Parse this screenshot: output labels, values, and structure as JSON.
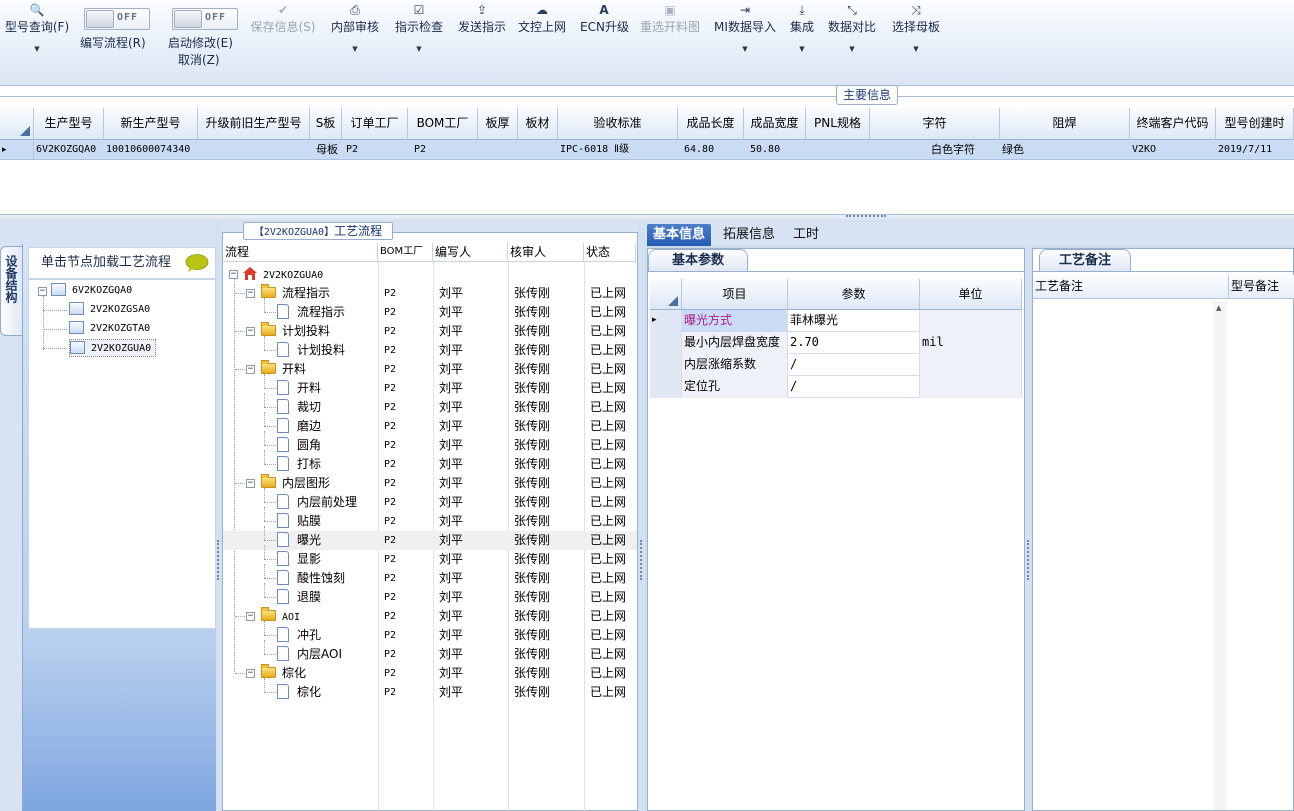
{
  "toolbar": {
    "buttons": [
      {
        "label": "型号查询(F)",
        "icon": "search-icon",
        "dropdown": true
      },
      {
        "label": "保存信息(S)",
        "icon": "check-icon",
        "disabled": true
      },
      {
        "label": "内部审核",
        "icon": "printer-icon",
        "dropdown": true
      },
      {
        "label": "指示检查",
        "icon": "check-square-icon",
        "dropdown": true
      },
      {
        "label": "发送指示",
        "icon": "upload-icon"
      },
      {
        "label": "文控上网",
        "icon": "cloud-upload-icon"
      },
      {
        "label": "ECN升级",
        "icon": "text-a-icon"
      },
      {
        "label": "重选开料图",
        "icon": "image-icon",
        "disabled": true
      },
      {
        "label": "MI数据导入",
        "icon": "sign-in-icon",
        "dropdown": true
      },
      {
        "label": "集成",
        "icon": "download-icon",
        "dropdown": true
      },
      {
        "label": "数据对比",
        "icon": "compress-icon",
        "dropdown": true
      },
      {
        "label": "选择母板",
        "icon": "shuffle-icon",
        "dropdown": true
      }
    ],
    "toggles": [
      {
        "label": "编写流程(R)",
        "state": "OFF"
      },
      {
        "label": "启动修改(E)",
        "sublabel": "取消(Z)",
        "state": "OFF"
      }
    ]
  },
  "main_info": {
    "title": "主要信息",
    "columns": [
      "生产型号",
      "新生产型号",
      "升级前旧生产型号",
      "S板",
      "订单工厂",
      "BOM工厂",
      "板厚",
      "板材",
      "验收标准",
      "成品长度",
      "成品宽度",
      "PNL规格",
      "字符",
      "阻焊",
      "终端客户代码",
      "型号创建时"
    ],
    "rows": [
      [
        "6V2KOZGQA0",
        "10010600074340",
        "",
        "母板",
        "P2",
        "P2",
        "",
        "",
        "IPC-6018 Ⅱ级",
        "64.80",
        "50.80",
        "",
        "白色字符",
        "绿色",
        "V2KO",
        "2019/7/11"
      ]
    ]
  },
  "structure": {
    "vtab_label": "设备结构",
    "load_hint": "单击节点加载工艺流程",
    "tree": [
      {
        "label": "6V2KOZGQA0",
        "level": 0
      },
      {
        "label": "2V2KOZGSA0",
        "level": 1
      },
      {
        "label": "2V2KOZGTA0",
        "level": 1
      },
      {
        "label": "2V2KOZGUA0",
        "level": 1,
        "selected": true
      }
    ]
  },
  "process": {
    "title_code": "【2V2KOZGUA0】",
    "title_text": "工艺流程",
    "columns": [
      "流程",
      "BOM工厂",
      "编写人",
      "核审人",
      "状态"
    ],
    "rows": [
      {
        "name": "2V2KOZGUA0",
        "type": "root",
        "level": 0,
        "bom": "",
        "writer": "",
        "reviewer": "",
        "status": ""
      },
      {
        "name": "流程指示",
        "type": "folder",
        "level": 1,
        "bom": "P2",
        "writer": "刘平",
        "reviewer": "张传刚",
        "status": "已上网"
      },
      {
        "name": "流程指示",
        "type": "doc",
        "level": 2,
        "bom": "P2",
        "writer": "刘平",
        "reviewer": "张传刚",
        "status": "已上网"
      },
      {
        "name": "计划投料",
        "type": "folder",
        "level": 1,
        "bom": "P2",
        "writer": "刘平",
        "reviewer": "张传刚",
        "status": "已上网"
      },
      {
        "name": "计划投料",
        "type": "doc",
        "level": 2,
        "bom": "P2",
        "writer": "刘平",
        "reviewer": "张传刚",
        "status": "已上网"
      },
      {
        "name": "开料",
        "type": "folder",
        "level": 1,
        "bom": "P2",
        "writer": "刘平",
        "reviewer": "张传刚",
        "status": "已上网"
      },
      {
        "name": "开料",
        "type": "doc",
        "level": 2,
        "bom": "P2",
        "writer": "刘平",
        "reviewer": "张传刚",
        "status": "已上网"
      },
      {
        "name": "裁切",
        "type": "doc",
        "level": 2,
        "bom": "P2",
        "writer": "刘平",
        "reviewer": "张传刚",
        "status": "已上网"
      },
      {
        "name": "磨边",
        "type": "doc",
        "level": 2,
        "bom": "P2",
        "writer": "刘平",
        "reviewer": "张传刚",
        "status": "已上网"
      },
      {
        "name": "圆角",
        "type": "doc",
        "level": 2,
        "bom": "P2",
        "writer": "刘平",
        "reviewer": "张传刚",
        "status": "已上网"
      },
      {
        "name": "打标",
        "type": "doc",
        "level": 2,
        "bom": "P2",
        "writer": "刘平",
        "reviewer": "张传刚",
        "status": "已上网"
      },
      {
        "name": "内层图形",
        "type": "folder",
        "level": 1,
        "bom": "P2",
        "writer": "刘平",
        "reviewer": "张传刚",
        "status": "已上网"
      },
      {
        "name": "内层前处理",
        "type": "doc",
        "level": 2,
        "bom": "P2",
        "writer": "刘平",
        "reviewer": "张传刚",
        "status": "已上网"
      },
      {
        "name": "贴膜",
        "type": "doc",
        "level": 2,
        "bom": "P2",
        "writer": "刘平",
        "reviewer": "张传刚",
        "status": "已上网"
      },
      {
        "name": "曝光",
        "type": "doc",
        "level": 2,
        "bom": "P2",
        "writer": "刘平",
        "reviewer": "张传刚",
        "status": "已上网",
        "selected": true
      },
      {
        "name": "显影",
        "type": "doc",
        "level": 2,
        "bom": "P2",
        "writer": "刘平",
        "reviewer": "张传刚",
        "status": "已上网"
      },
      {
        "name": "酸性蚀刻",
        "type": "doc",
        "level": 2,
        "bom": "P2",
        "writer": "刘平",
        "reviewer": "张传刚",
        "status": "已上网"
      },
      {
        "name": "退膜",
        "type": "doc",
        "level": 2,
        "bom": "P2",
        "writer": "刘平",
        "reviewer": "张传刚",
        "status": "已上网"
      },
      {
        "name": "AOI",
        "type": "folder",
        "level": 1,
        "bom": "P2",
        "writer": "刘平",
        "reviewer": "张传刚",
        "status": "已上网"
      },
      {
        "name": "冲孔",
        "type": "doc",
        "level": 2,
        "bom": "P2",
        "writer": "刘平",
        "reviewer": "张传刚",
        "status": "已上网"
      },
      {
        "name": "内层AOI",
        "type": "doc",
        "level": 2,
        "bom": "P2",
        "writer": "刘平",
        "reviewer": "张传刚",
        "status": "已上网"
      },
      {
        "name": "棕化",
        "type": "folder",
        "level": 1,
        "bom": "P2",
        "writer": "刘平",
        "reviewer": "张传刚",
        "status": "已上网"
      },
      {
        "name": "棕化",
        "type": "doc",
        "level": 2,
        "bom": "P2",
        "writer": "刘平",
        "reviewer": "张传刚",
        "status": "已上网"
      }
    ]
  },
  "right_tabs": [
    "基本信息",
    "拓展信息",
    "工时"
  ],
  "basic_params": {
    "tab": "基本参数",
    "columns": [
      "项目",
      "参数",
      "单位"
    ],
    "rows": [
      {
        "item": "曝光方式",
        "value": "菲林曝光",
        "unit": "",
        "highlight": true
      },
      {
        "item": "最小内层焊盘宽度",
        "value": "2.70",
        "unit": "mil"
      },
      {
        "item": "内层涨缩系数",
        "value": "/",
        "unit": ""
      },
      {
        "item": "定位孔",
        "value": "/",
        "unit": ""
      }
    ]
  },
  "notes": {
    "tab": "工艺备注",
    "columns": [
      "工艺备注",
      "型号备注"
    ]
  },
  "colors": {
    "accent": "#245cb2",
    "selected_row": "#c9dcf4",
    "highlight_text": "#b0198c"
  }
}
